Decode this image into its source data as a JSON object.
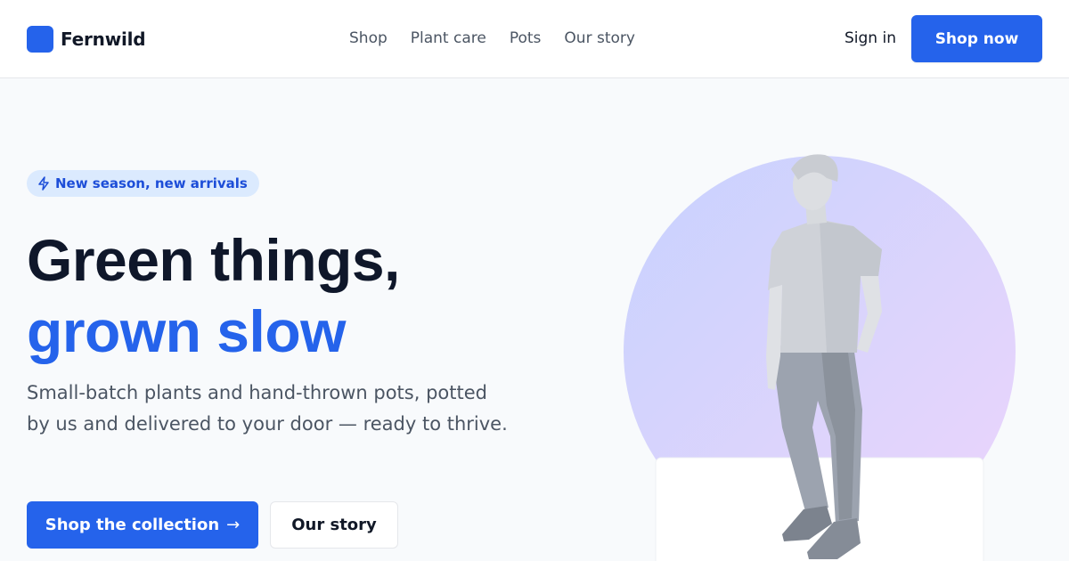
{
  "brand": {
    "name": "Fernwild"
  },
  "nav": {
    "items": [
      "Shop",
      "Plant care",
      "Pots",
      "Our story"
    ]
  },
  "header": {
    "signin_label": "Sign in",
    "cta_label": "Shop now"
  },
  "hero": {
    "badge": "New season, new arrivals",
    "headline_line1": "Green things,",
    "headline_line2": "grown slow",
    "lede": "Small-batch plants and hand-thrown pots, potted by us and delivered to your door — ready to thrive.",
    "primary_cta": "Shop the collection",
    "primary_cta_arrow": "→",
    "secondary_cta": "Our story"
  },
  "colors": {
    "accent": "#2563eb",
    "badge_bg": "#dbeafe",
    "heading": "#0f172a",
    "body_text": "#4b5563",
    "circle_top": "#c7d2fe",
    "circle_bottom": "#e9d5ff"
  },
  "icons": {
    "badge": "lightning-bolt-icon",
    "logo": "brand-mark-icon"
  },
  "illustration": {
    "subject": "standing-man-illustration"
  }
}
